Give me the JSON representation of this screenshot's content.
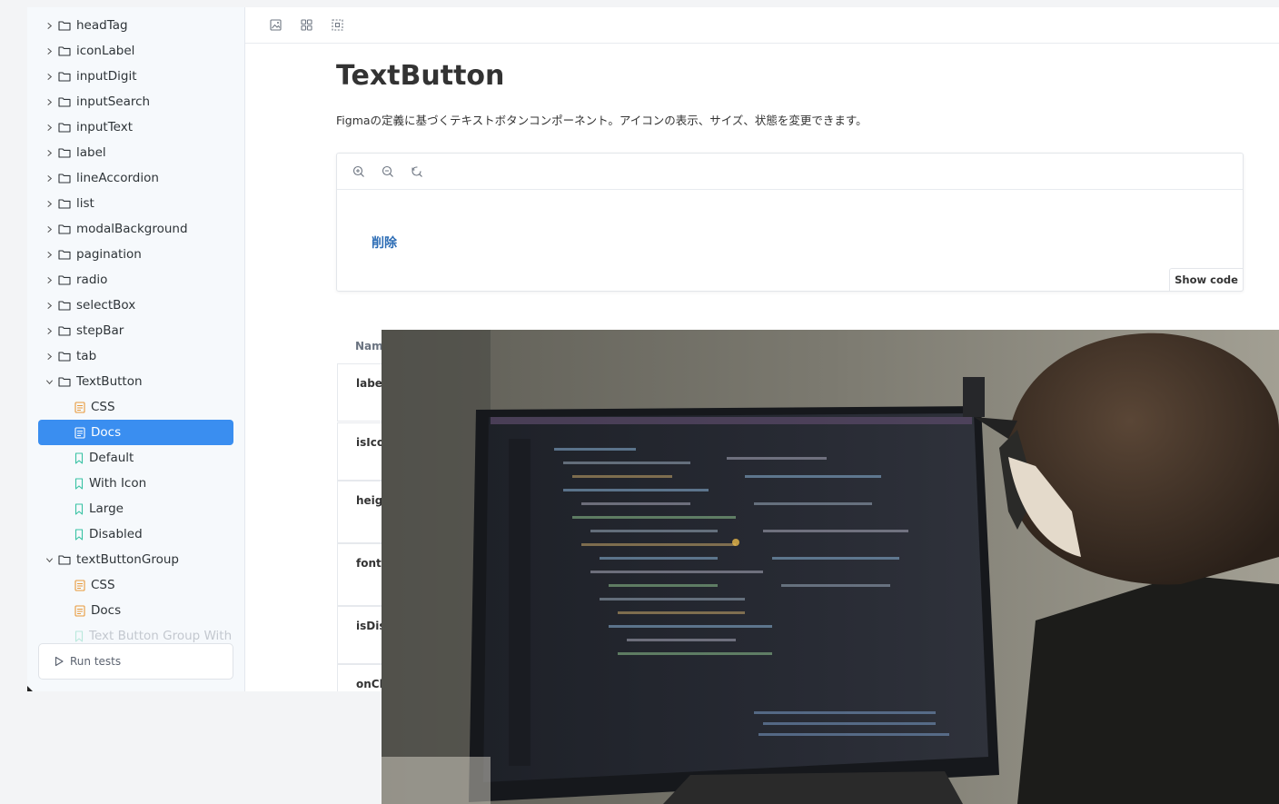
{
  "sidebar": {
    "items": [
      {
        "label": "headTag",
        "kind": "folder",
        "expanded": false
      },
      {
        "label": "iconLabel",
        "kind": "folder",
        "expanded": false
      },
      {
        "label": "inputDigit",
        "kind": "folder",
        "expanded": false
      },
      {
        "label": "inputSearch",
        "kind": "folder",
        "expanded": false
      },
      {
        "label": "inputText",
        "kind": "folder",
        "expanded": false
      },
      {
        "label": "label",
        "kind": "folder",
        "expanded": false
      },
      {
        "label": "lineAccordion",
        "kind": "folder",
        "expanded": false
      },
      {
        "label": "list",
        "kind": "folder",
        "expanded": false
      },
      {
        "label": "modalBackground",
        "kind": "folder",
        "expanded": false
      },
      {
        "label": "pagination",
        "kind": "folder",
        "expanded": false
      },
      {
        "label": "radio",
        "kind": "folder",
        "expanded": false
      },
      {
        "label": "selectBox",
        "kind": "folder",
        "expanded": false
      },
      {
        "label": "stepBar",
        "kind": "folder",
        "expanded": false
      },
      {
        "label": "tab",
        "kind": "folder",
        "expanded": false
      },
      {
        "label": "TextButton",
        "kind": "folder",
        "expanded": true
      },
      {
        "label": "CSS",
        "kind": "doc"
      },
      {
        "label": "Docs",
        "kind": "doc",
        "selected": true
      },
      {
        "label": "Default",
        "kind": "story"
      },
      {
        "label": "With Icon",
        "kind": "story"
      },
      {
        "label": "Large",
        "kind": "story"
      },
      {
        "label": "Disabled",
        "kind": "story"
      },
      {
        "label": "textButtonGroup",
        "kind": "folder",
        "expanded": true
      },
      {
        "label": "CSS",
        "kind": "doc"
      },
      {
        "label": "Docs",
        "kind": "doc"
      },
      {
        "label": "Text Button Group With",
        "kind": "story",
        "faded": true
      }
    ],
    "run_tests_label": "Run tests"
  },
  "toolbar": {
    "icons": [
      "image-icon",
      "grid-icon",
      "outline-icon"
    ]
  },
  "main": {
    "title": "TextButton",
    "description": "Figmaの定義に基づくテキストボタンコンポーネント。アイコンの表示、サイズ、状態を変更できます。",
    "preview": {
      "tools": [
        "zoom-in-icon",
        "zoom-out-icon",
        "reset-zoom-icon"
      ],
      "button_label": "削除",
      "show_code_label": "Show code"
    },
    "props": {
      "header": "Nam",
      "rows": [
        "label",
        "isIco",
        "heigl",
        "fontS",
        "isDis",
        "onCl"
      ]
    }
  },
  "colors": {
    "accent": "#3a8ef0",
    "link": "#2d6db5",
    "doc_icon": "#e8993a",
    "story_icon": "#38c2a3"
  }
}
